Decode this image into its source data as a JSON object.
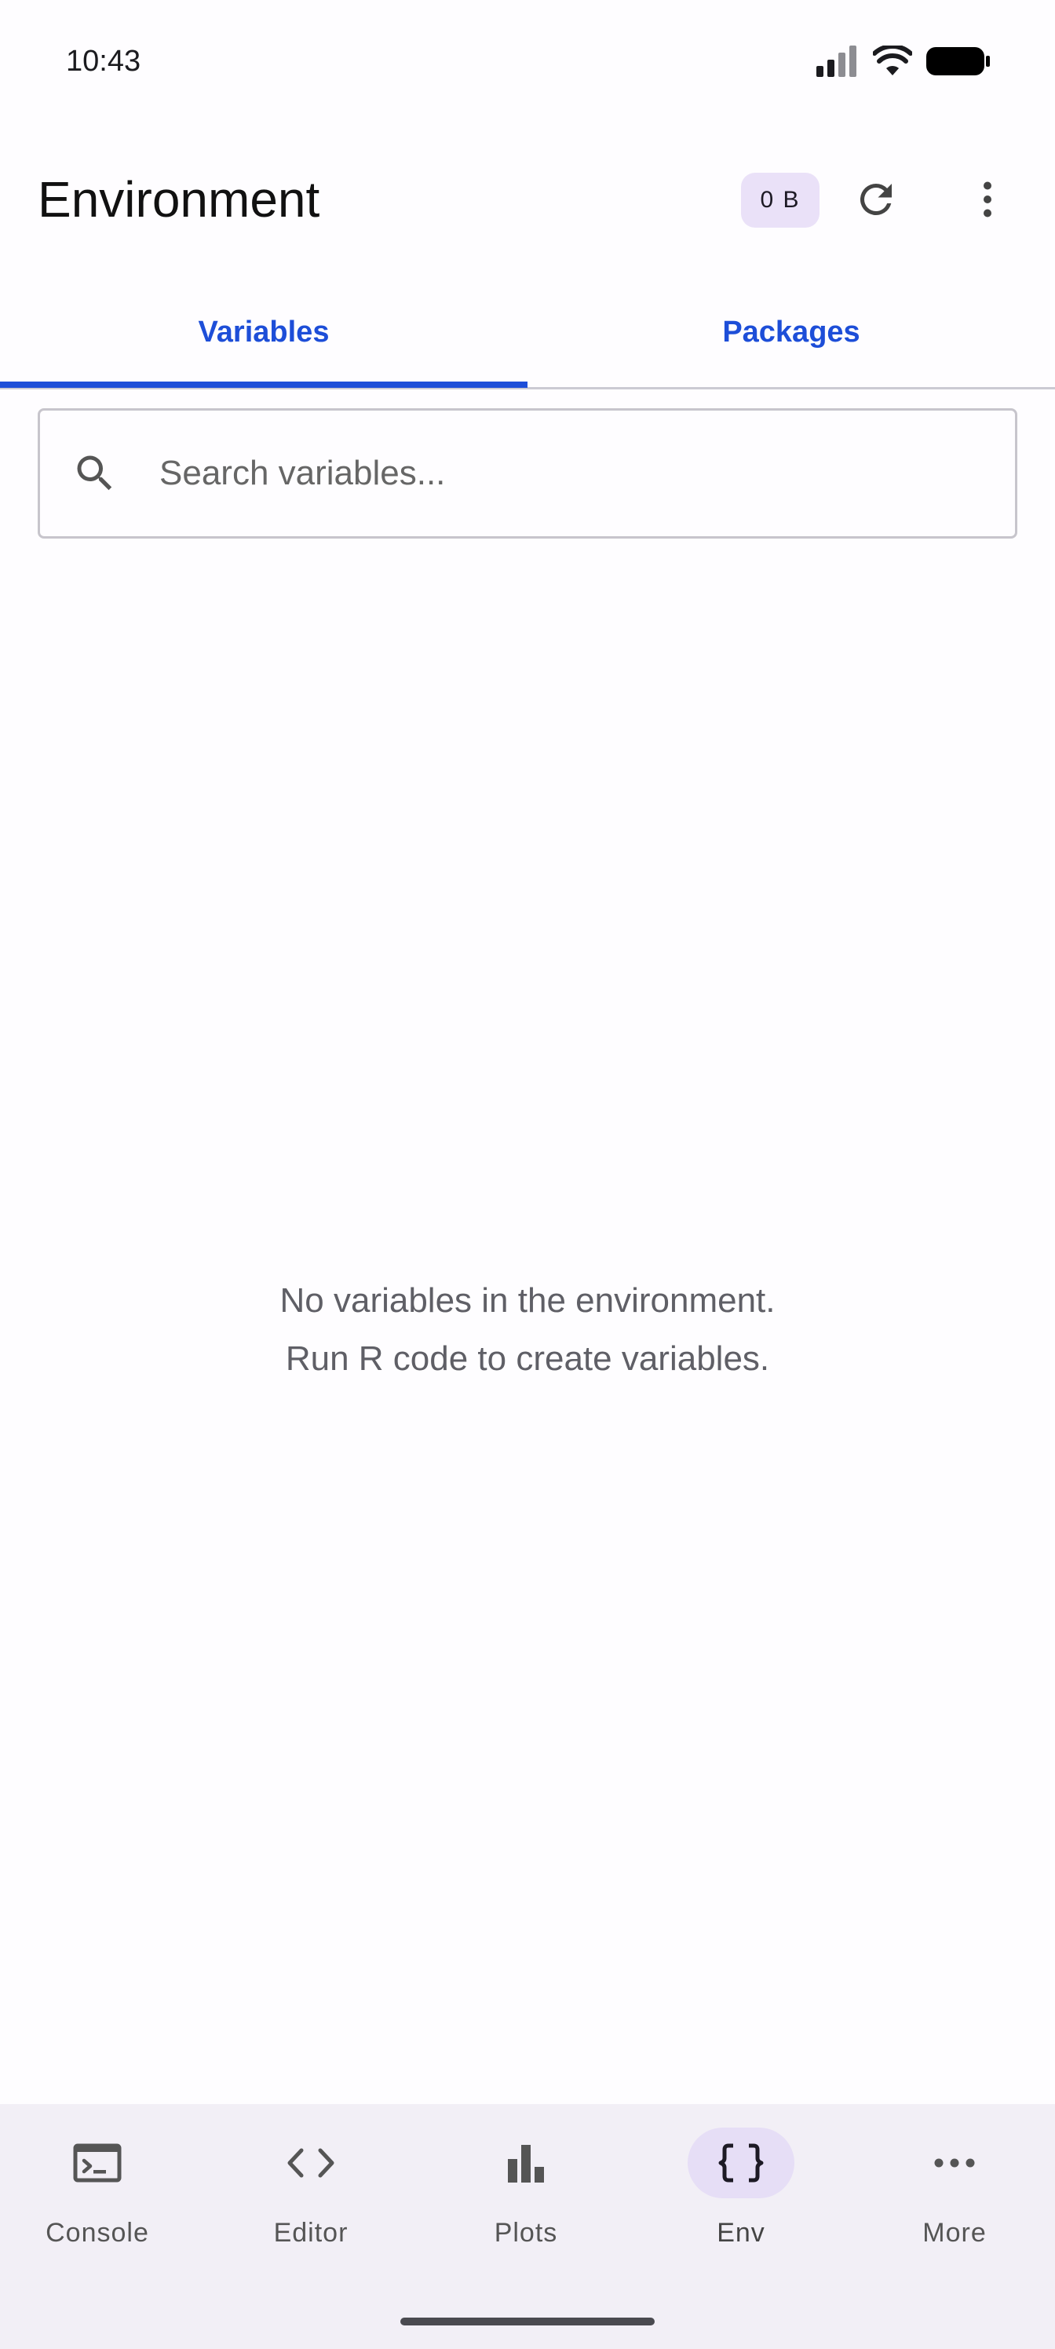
{
  "status_bar": {
    "time": "10:43",
    "icons": [
      "signal-icon",
      "wifi-icon",
      "battery-icon"
    ]
  },
  "app_bar": {
    "title": "Environment",
    "memory_chip": "0 B",
    "refresh_icon": "refresh-icon",
    "more_icon": "more-vertical-icon"
  },
  "tabs": {
    "items": [
      {
        "label": "Variables",
        "selected": true
      },
      {
        "label": "Packages",
        "selected": false
      }
    ]
  },
  "search": {
    "placeholder": "Search variables...",
    "value": "",
    "icon": "search-icon"
  },
  "empty_state": {
    "line1": "No variables in the environment.",
    "line2": "Run R code to create variables."
  },
  "bottom_nav": {
    "items": [
      {
        "label": "Console",
        "icon": "terminal-icon",
        "active": false
      },
      {
        "label": "Editor",
        "icon": "code-icon",
        "active": false
      },
      {
        "label": "Plots",
        "icon": "bar-chart-icon",
        "active": false
      },
      {
        "label": "Env",
        "icon": "braces-icon",
        "active": true
      },
      {
        "label": "More",
        "icon": "more-horizontal-icon",
        "active": false
      }
    ]
  },
  "colors": {
    "accent": "#1d4ed8",
    "chip_bg": "#eae1f8",
    "nav_bg": "#f2eff6",
    "nav_active_bg": "#e6def6",
    "text_secondary": "#5f5f66"
  }
}
